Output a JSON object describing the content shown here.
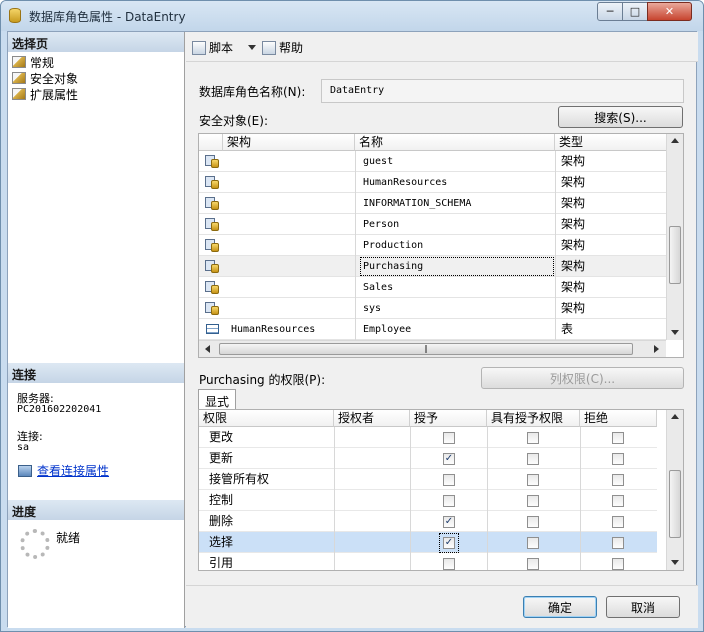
{
  "window": {
    "title": "数据库角色属性 - DataEntry"
  },
  "sidebar": {
    "select_page_header": "选择页",
    "pages": [
      {
        "label": "常规",
        "icon": "page-icon"
      },
      {
        "label": "安全对象",
        "icon": "page-icon"
      },
      {
        "label": "扩展属性",
        "icon": "page-icon"
      }
    ],
    "connection_header": "连接",
    "server_label": "服务器:",
    "server_value": "PC201602202041",
    "conn_label": "连接:",
    "conn_value": "sa",
    "view_conn_link": "查看连接属性",
    "progress_header": "进度",
    "progress_status": "就绪"
  },
  "toolbar": {
    "script_label": "脚本",
    "help_label": "帮助"
  },
  "form": {
    "role_name_label": "数据库角色名称(N):",
    "role_name_value": "DataEntry",
    "securables_label": "安全对象(E):",
    "search_button": "搜索(S)...",
    "permissions_label": "Purchasing 的权限(P):",
    "column_perms_button": "列权限(C)..."
  },
  "securables": {
    "columns": [
      "架构",
      "名称",
      "类型"
    ],
    "rows": [
      {
        "schema": "",
        "name": "guest",
        "type": "架构",
        "icon": "schema-icon"
      },
      {
        "schema": "",
        "name": "HumanResources",
        "type": "架构",
        "icon": "schema-icon"
      },
      {
        "schema": "",
        "name": "INFORMATION_SCHEMA",
        "type": "架构",
        "icon": "schema-icon"
      },
      {
        "schema": "",
        "name": "Person",
        "type": "架构",
        "icon": "schema-icon"
      },
      {
        "schema": "",
        "name": "Production",
        "type": "架构",
        "icon": "schema-icon"
      },
      {
        "schema": "",
        "name": "Purchasing",
        "type": "架构",
        "icon": "schema-icon",
        "selected": true
      },
      {
        "schema": "",
        "name": "Sales",
        "type": "架构",
        "icon": "schema-icon"
      },
      {
        "schema": "",
        "name": "sys",
        "type": "架构",
        "icon": "schema-icon"
      },
      {
        "schema": "HumanResources",
        "name": "Employee",
        "type": "表",
        "icon": "table-icon"
      }
    ]
  },
  "permissions": {
    "tab_label": "显式",
    "columns": [
      "权限",
      "授权者",
      "授予",
      "具有授予权限",
      "拒绝"
    ],
    "rows": [
      {
        "permission": "更改",
        "grantor": "",
        "grant": false,
        "with_grant": false,
        "deny": false
      },
      {
        "permission": "更新",
        "grantor": "",
        "grant": true,
        "with_grant": false,
        "deny": false
      },
      {
        "permission": "接管所有权",
        "grantor": "",
        "grant": false,
        "with_grant": false,
        "deny": false
      },
      {
        "permission": "控制",
        "grantor": "",
        "grant": false,
        "with_grant": false,
        "deny": false
      },
      {
        "permission": "删除",
        "grantor": "",
        "grant": true,
        "with_grant": false,
        "deny": false
      },
      {
        "permission": "选择",
        "grantor": "",
        "grant": true,
        "with_grant": false,
        "deny": false,
        "selected": true
      },
      {
        "permission": "引用",
        "grantor": "",
        "grant": false,
        "with_grant": false,
        "deny": false
      }
    ]
  },
  "footer": {
    "ok_label": "确定",
    "cancel_label": "取消"
  }
}
